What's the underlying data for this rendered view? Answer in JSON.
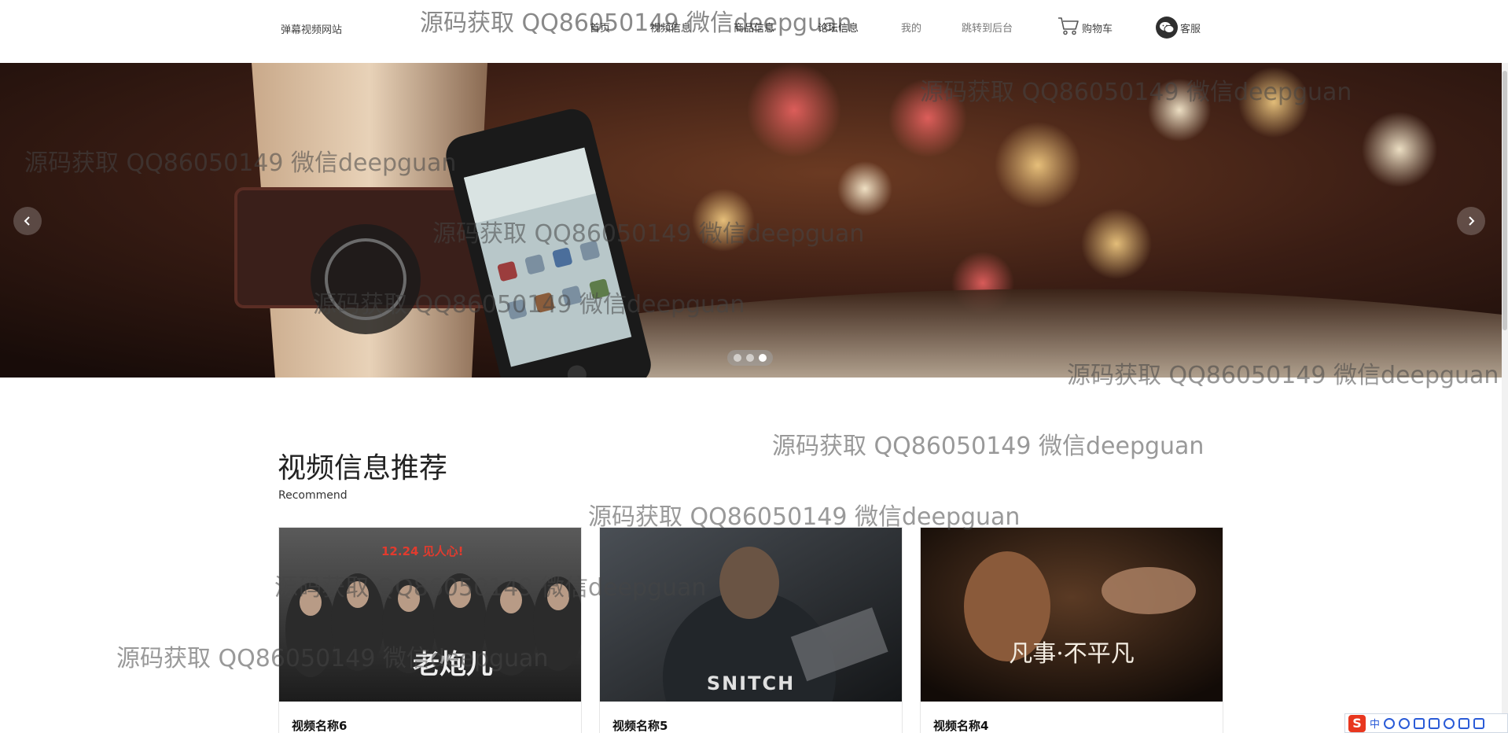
{
  "header": {
    "site_title": "弹幕视频网站",
    "nav": [
      {
        "label": "首页",
        "key": "home"
      },
      {
        "label": "视频信息",
        "key": "video"
      },
      {
        "label": "商品信息",
        "key": "goods"
      },
      {
        "label": "论坛信息",
        "key": "forum"
      },
      {
        "label": "我的",
        "key": "mine"
      },
      {
        "label": "跳转到后台",
        "key": "admin"
      }
    ],
    "cart_label": "购物车",
    "service_label": "客服"
  },
  "carousel": {
    "slide_count": 3,
    "active_index": 2
  },
  "section": {
    "title": "视频信息推荐",
    "subtitle": "Recommend"
  },
  "videos": [
    {
      "name": "视频名称6",
      "poster_text": "老炮儿",
      "poster_top_text": "12.24 见人心!"
    },
    {
      "name": "视频名称5",
      "poster_text": "SNITCH"
    },
    {
      "name": "视频名称4",
      "poster_text": "凡事·不平凡"
    }
  ],
  "watermark_text": "源码获取 QQ86050149 微信deepguan",
  "ime": {
    "logo": "S",
    "mode": "中"
  },
  "colors": {
    "accent_dark": "#222222",
    "ime_brand": "#e8371f"
  }
}
